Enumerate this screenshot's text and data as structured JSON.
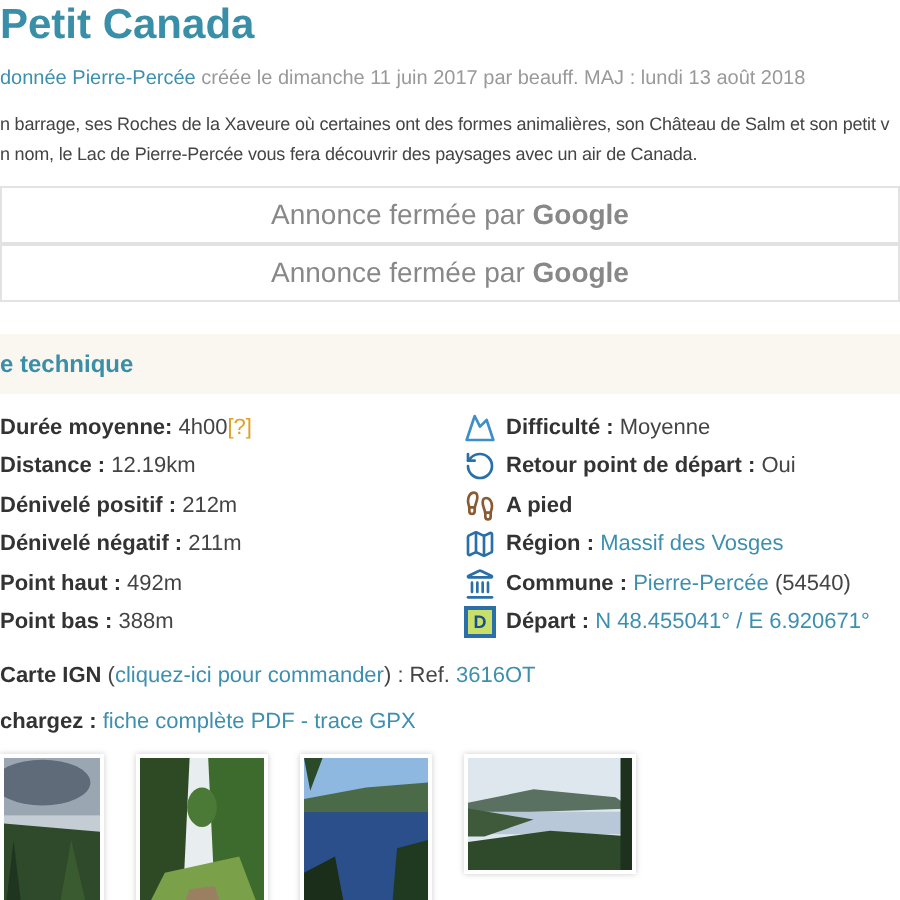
{
  "title": "Petit Canada",
  "meta": {
    "link": "donnée Pierre-Percée",
    "text": " créée le dimanche 11 juin 2017 par beauff. MAJ : lundi 13 août 2018"
  },
  "description": [
    "n barrage, ses Roches de la Xaveure où certaines ont des formes animalières, son Château de Salm et son petit v",
    "n nom, le Lac de Pierre-Percée vous fera découvrir des paysages avec un air de Canada."
  ],
  "ads": [
    "Annonce fermée par **Google**",
    "Annonce fermée par **Google**"
  ],
  "section": {
    "title": "e technique"
  },
  "left_rows": [
    {
      "label": "Durée moyenne: ",
      "value": "4h00",
      "help": "[?]"
    },
    {
      "label": "Distance : ",
      "value": "12.19km"
    },
    {
      "label": "Dénivelé positif : ",
      "value": "212m"
    },
    {
      "label": "Dénivelé négatif : ",
      "value": "211m"
    },
    {
      "label": "Point haut : ",
      "value": "492m"
    },
    {
      "label": "Point bas : ",
      "value": "388m"
    }
  ],
  "right_rows": [
    {
      "kind": "difficulty",
      "label": "Difficulté : ",
      "value": "Moyenne"
    },
    {
      "kind": "loop",
      "label": "Retour point de départ : ",
      "value": "Oui"
    },
    {
      "kind": "mode",
      "label": "A pied"
    },
    {
      "kind": "region",
      "label": "Région : ",
      "link": "Massif des Vosges"
    },
    {
      "kind": "commune",
      "label": "Commune : ",
      "link": "Pierre-Percée",
      "value": " (54540)"
    },
    {
      "kind": "start",
      "badge": "D",
      "label": "Départ : ",
      "link": "N 48.455041° / E 6.920671°"
    }
  ],
  "map_line": {
    "label": "Carte IGN ",
    "open": "(",
    "link": "cliquez-ici pour commander",
    "close": ") : Ref. ",
    "ref": "3616OT"
  },
  "download_line": {
    "label": "chargez : ",
    "link": "fiche complète PDF - trace GPX"
  }
}
